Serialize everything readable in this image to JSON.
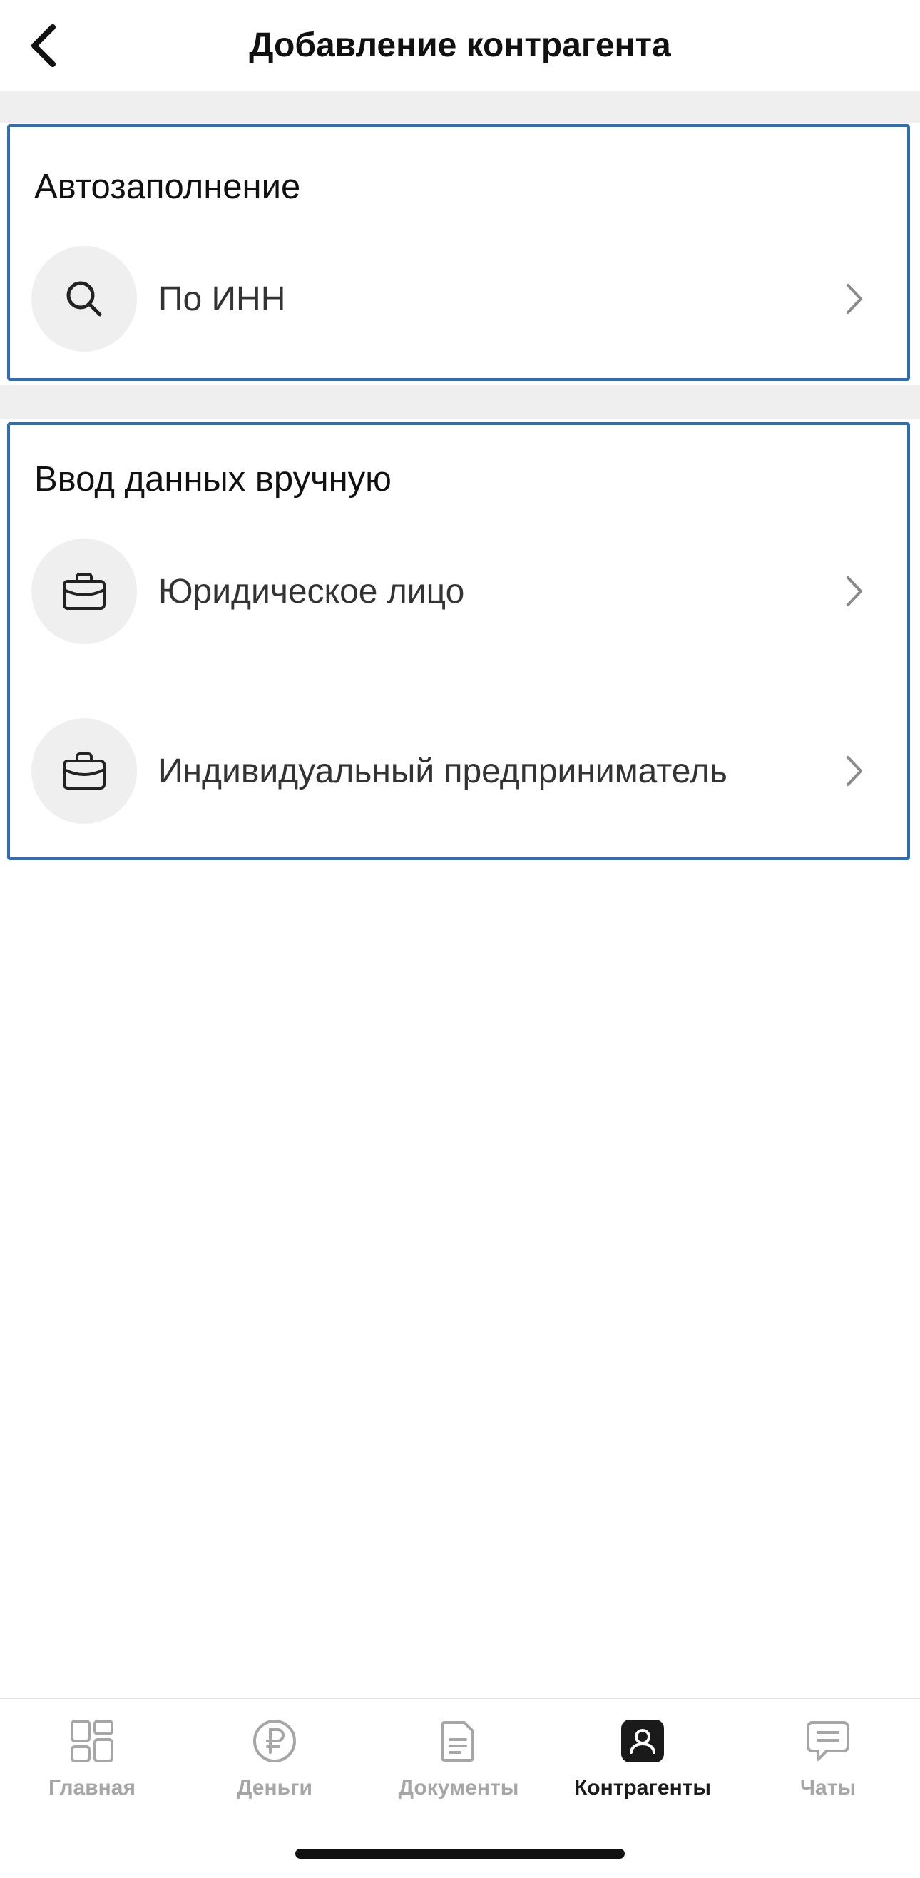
{
  "header": {
    "title": "Добавление контрагента",
    "back_icon": "chevron-left-icon"
  },
  "autofill": {
    "title": "Автозаполнение",
    "items": [
      {
        "label": "По ИНН",
        "icon": "search-icon"
      }
    ]
  },
  "manual": {
    "title": "Ввод данных вручную",
    "items": [
      {
        "label": "Юридическое лицо",
        "icon": "briefcase-icon"
      },
      {
        "label": "Индивидуальный предприниматель",
        "icon": "briefcase-icon"
      }
    ]
  },
  "tabbar": {
    "items": [
      {
        "label": "Главная",
        "icon": "grid-icon",
        "active": false
      },
      {
        "label": "Деньги",
        "icon": "ruble-icon",
        "active": false
      },
      {
        "label": "Документы",
        "icon": "document-icon",
        "active": false
      },
      {
        "label": "Контрагенты",
        "icon": "person-icon",
        "active": true
      },
      {
        "label": "Чаты",
        "icon": "chat-icon",
        "active": false
      }
    ]
  },
  "colors": {
    "section_border": "#2f6fb0",
    "icon_circle_bg": "#efefef",
    "tab_inactive": "#a6a6a6",
    "tab_active": "#1a1a1a"
  }
}
